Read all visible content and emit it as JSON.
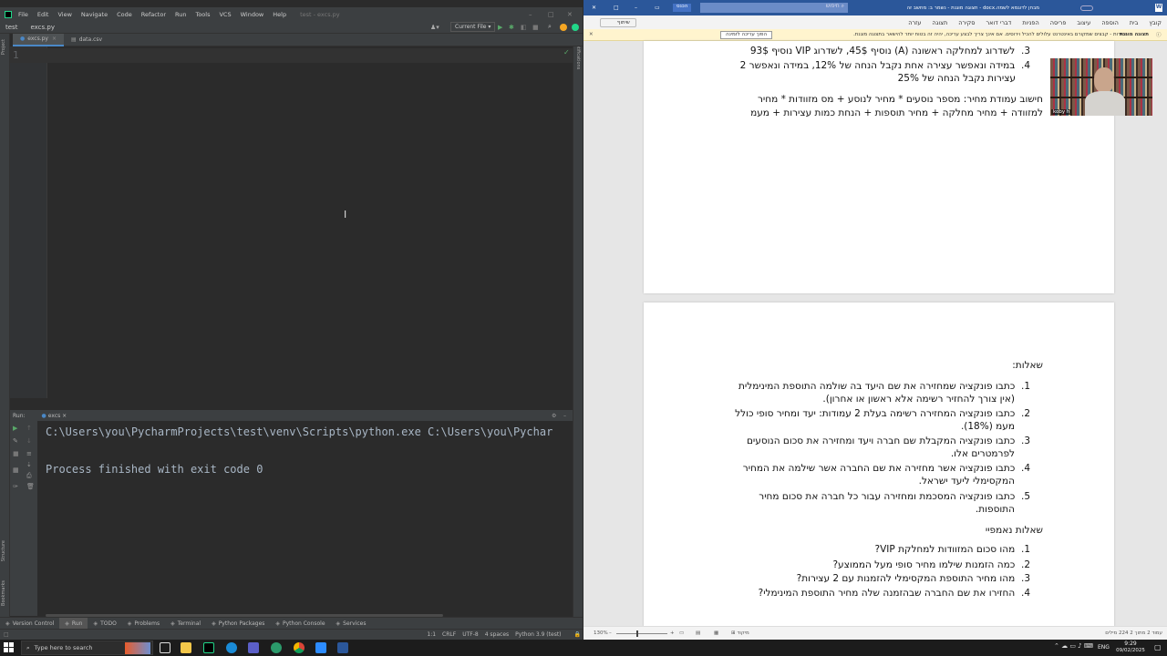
{
  "pycharm": {
    "menu": [
      "File",
      "Edit",
      "View",
      "Navigate",
      "Code",
      "Refactor",
      "Run",
      "Tools",
      "VCS",
      "Window",
      "Help"
    ],
    "window_title": "test - excs.py",
    "project": "test",
    "file": "excs.py",
    "run_config": "Current File",
    "tabs": [
      "excs.py",
      "data.csv"
    ],
    "line_number": "1",
    "left_strip": [
      "Project",
      "Structure",
      "Bookmarks"
    ],
    "right_strip": "Notifications",
    "run": {
      "label": "Run:",
      "config": "excs",
      "cmd": "C:\\Users\\you\\PycharmProjects\\test\\venv\\Scripts\\python.exe C:\\Users\\you\\Pychar",
      "exit": "Process finished with exit code 0"
    },
    "bottom_tabs": [
      "Version Control",
      "Run",
      "TODO",
      "Problems",
      "Terminal",
      "Python Packages",
      "Python Console",
      "Services"
    ],
    "status": [
      "1:1",
      "CRLF",
      "UTF-8",
      "4 spaces",
      "Python 3.9 (test)"
    ]
  },
  "word": {
    "title": "מבחן לדוגמא לשמה.docx - תצוגה מוגנת - נשמר ב: מחשב זה",
    "search": "חיפוש",
    "signin": "הכנס",
    "ribbon_tabs": [
      "קובץ",
      "בית",
      "הוספה",
      "עיצוב",
      "פריסה",
      "הפניות",
      "דברי דואר",
      "סקירה",
      "תצוגה",
      "עזרה"
    ],
    "share_label": "שיתוף",
    "protected_label": "תצוגה מוגנת",
    "protected_msg": "זהירות - קבצים שמקורם באינטרנט עלולים להכיל וירוסים. אם אינך צריך לבצע עריכה, יהיה זה בטוח יותר להישאר בתצוגה מוגנת.",
    "enable_btn": "הפוך עריכה לזמינה",
    "page1": [
      {
        "n": "3.",
        "t": "לשדרוג למחלקה ראשונה (A) נוסיף 45$, לשדרוג VIP נוסיף 93$"
      },
      {
        "n": "4.",
        "t": "במידה ונאפשר עצירה אחת נקבל הנחה של 12%, במידה ונאפשר 2"
      },
      {
        "n": "",
        "t": "עצירות נקבל הנחה של 25%"
      }
    ],
    "calc1": "חישוב עמודת מחיר: מספר נוסעים * מחיר לנוסע + מס מזוודות * מחיר",
    "calc2": "למזוודה + מחיר מחלקה + מחיר תוספות + הנחת כמות עצירות + מעמ",
    "video_name": "koby h",
    "questions_title": "שאלות:",
    "questions": [
      {
        "n": "1.",
        "l1": "כתבו פונקציה שמחזירה את שם היעד בה שולמה התוספת המינימלית",
        "l2": "(אין צורך להחזיר רשימה אלא ראשון או אחרון)."
      },
      {
        "n": "2.",
        "l1": "כתבו פונקציה המחזירה רשימה בעלת 2 עמודות: יעד ומחיר סופי כולל",
        "l2": "מעמ (18%)."
      },
      {
        "n": "3.",
        "l1": "כתבו פונקציה המקבלת שם חברה ויעד ומחזירה את סכום הנוסעים",
        "l2": "לפרמטרים אלו."
      },
      {
        "n": "4.",
        "l1": "כתבו פונקציה אשר מחזירה את שם החברה אשר שילמה את המחיר",
        "l2": "המקסימלי ליעד ישראל."
      },
      {
        "n": "5.",
        "l1": "כתבו פונקציה המסכמת ומחזירה עבור כל חברה את סכום מחיר",
        "l2": "התוספות."
      }
    ],
    "numpy_title": "שאלות נאמפיי",
    "numpy": [
      {
        "n": "1.",
        "t": "מהו סכום המזוודות למחלקת VIP?"
      },
      {
        "n": "2.",
        "t": "כמה הזמנות שילמו מחיר סופי מעל הממוצע?"
      },
      {
        "n": "3.",
        "t": "מהו מחיר התוספת המקסימלי להזמנות עם 2 עצירות?"
      },
      {
        "n": "4.",
        "t": "החזירו את שם החברה שבהזמנה שלה מחיר התוספת המינימלי?"
      }
    ],
    "status_left": "עמוד 2 מתוך 2   224 מילים",
    "zoom": "130%",
    "focus": "מיקוד"
  },
  "taskbar": {
    "search_placeholder": "Type here to search",
    "lang": "ENG",
    "time": "9:29",
    "date": "09/02/2025"
  }
}
